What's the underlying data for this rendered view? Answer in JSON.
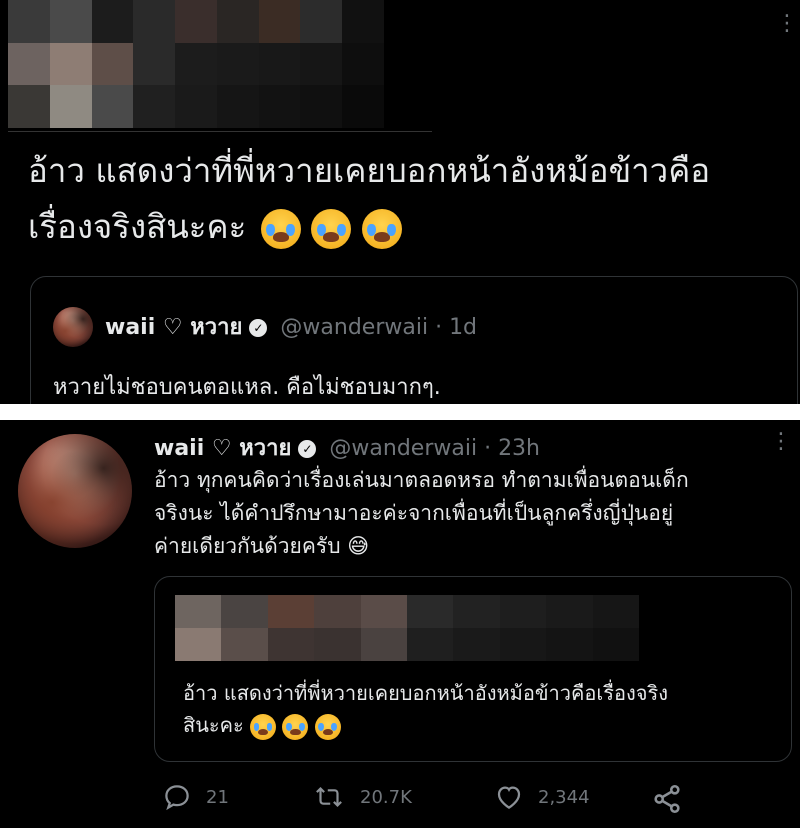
{
  "top_screenshot": {
    "pixelated_colors": [
      [
        "#3a3a3a",
        "#4a4a4a",
        "#1c1c1c",
        "#2a2a2a",
        "#3a2e2c",
        "#2a2624",
        "#3b2c24",
        "#2c2c2c",
        "#111111"
      ],
      [
        "#6d6360",
        "#8e7d74",
        "#5e4e48",
        "#2a2a2a",
        "#1c1c1c",
        "#1a1a1a",
        "#181818",
        "#161616",
        "#0e0e0e"
      ],
      [
        "#3a3835",
        "#8f8a82",
        "#4a4a4a",
        "#202020",
        "#1a1a1a",
        "#151515",
        "#121212",
        "#101010",
        "#0a0a0a"
      ]
    ],
    "tweet_text_line1": "อ้าว แสดงว่าที่พี่หวายเคยบอกหน้าอังหม้อข้าวคือ",
    "tweet_text_line2": "เรื่องจริงสินะคะ",
    "quoted": {
      "display_name": "waii ♡ หวาย",
      "handle": "@wanderwaii",
      "time": "· 1d",
      "text": "หวายไม่ชอบคนตอแหล. คือไม่ชอบมากๆ."
    }
  },
  "bottom_screenshot": {
    "display_name": "waii ♡ หวาย",
    "handle": "@wanderwaii",
    "time": "· 23h",
    "text_line1": "อ้าว ทุกคนคิดว่าเรื่องเล่นมาตลอดหรอ ทำตามเพื่อนตอนเด็ก",
    "text_line2": "จริงนะ ได้คำปรึกษามาอะค่ะจากเพื่อนที่เป็นลูกครึ่งญี่ปุ่นอยู่",
    "text_line3": "ค่ายเดียวกันด้วยครับ",
    "text_line3_emoji": "😅",
    "quoted_pixelated_colors": [
      [
        "#6e6560",
        "#4a4442",
        "#5b3f35",
        "#4e403c",
        "#5a4c48",
        "#2a2a2a",
        "#222222",
        "#1e1e1e",
        "#1a1a1a",
        "#161616"
      ],
      [
        "#8a7a72",
        "#5a4e4a",
        "#3e3432",
        "#3a3230",
        "#4a4240",
        "#1f1f1f",
        "#1a1a1a",
        "#171717",
        "#141414",
        "#111111"
      ]
    ],
    "quoted_text_line1": "อ้าว แสดงว่าที่พี่หวายเคยบอกหน้าอังหม้อข้าวคือเรื่องจริง",
    "quoted_text_line2": "สินะคะ",
    "replies": "21",
    "retweets": "20.7K",
    "likes": "2,344"
  },
  "icons": {
    "more": "more-vertical-icon",
    "verified": "verified-badge-icon",
    "reply": "reply-icon",
    "retweet": "retweet-icon",
    "like": "heart-icon",
    "share": "share-icon"
  }
}
